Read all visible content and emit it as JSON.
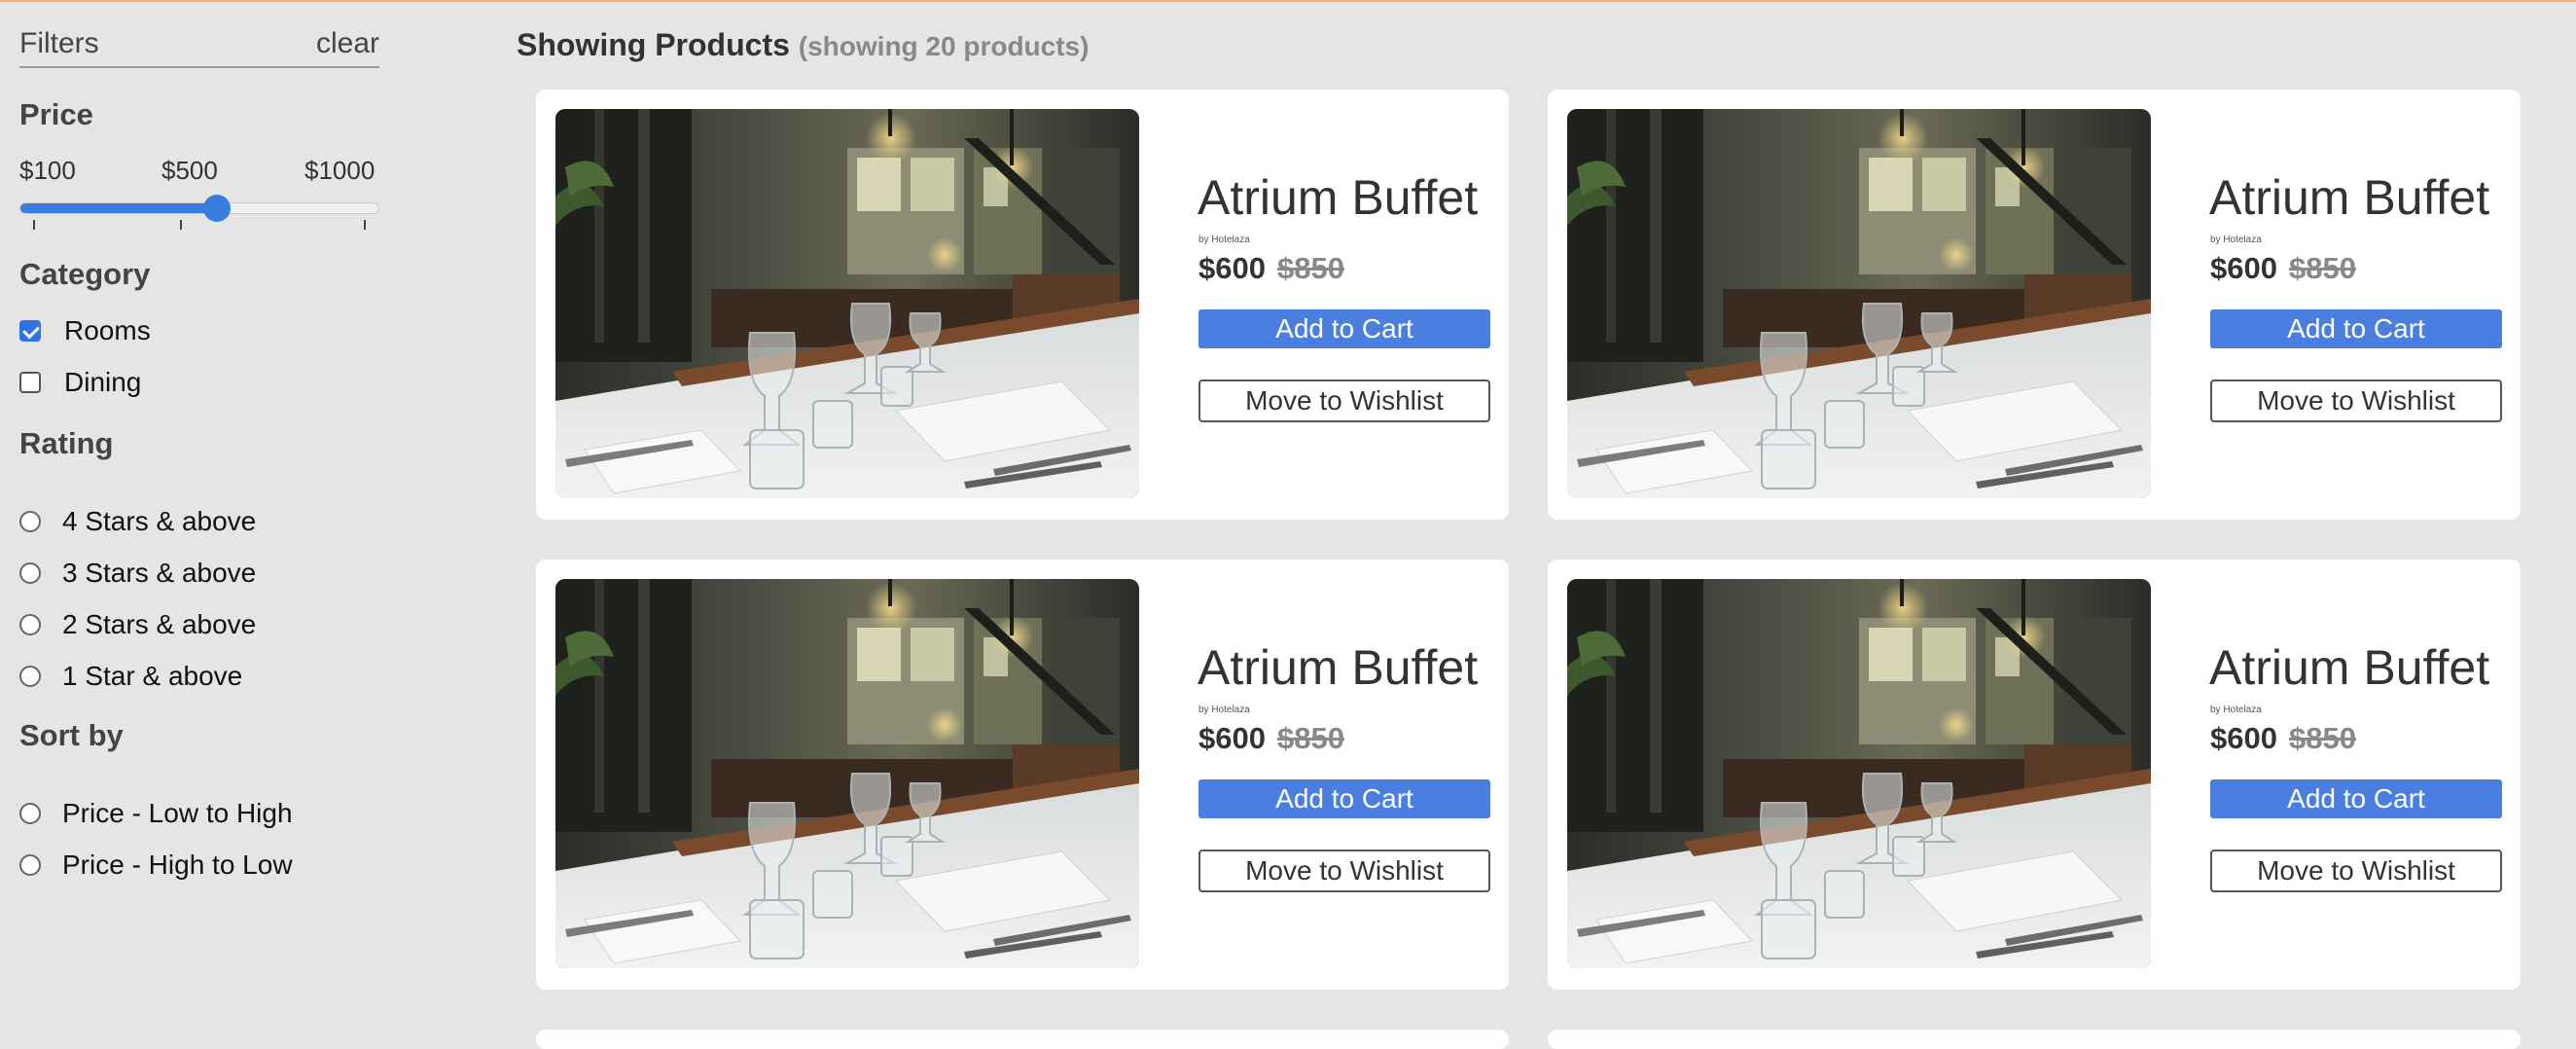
{
  "filters": {
    "title": "Filters",
    "clear_label": "clear",
    "price": {
      "title": "Price",
      "labels": [
        "$100",
        "$500",
        "$1000"
      ],
      "value_fraction": 0.55
    },
    "category": {
      "title": "Category",
      "options": [
        {
          "label": "Rooms",
          "checked": true
        },
        {
          "label": "Dining",
          "checked": false
        }
      ]
    },
    "rating": {
      "title": "Rating",
      "options": [
        "4 Stars & above",
        "3 Stars & above",
        "2 Stars & above",
        "1 Star & above"
      ]
    },
    "sort": {
      "title": "Sort by",
      "options": [
        "Price - Low to High",
        "Price - High to Low"
      ]
    }
  },
  "main": {
    "heading": "Showing Products",
    "count_text": "(showing 20 products)"
  },
  "products": [
    {
      "name": "Atrium Buffet",
      "brand": "by Hotelaza",
      "price": "$600",
      "old_price": "$850",
      "cart_label": "Add to Cart",
      "wishlist_label": "Move to Wishlist"
    },
    {
      "name": "Atrium Buffet",
      "brand": "by Hotelaza",
      "price": "$600",
      "old_price": "$850",
      "cart_label": "Add to Cart",
      "wishlist_label": "Move to Wishlist"
    },
    {
      "name": "Atrium Buffet",
      "brand": "by Hotelaza",
      "price": "$600",
      "old_price": "$850",
      "cart_label": "Add to Cart",
      "wishlist_label": "Move to Wishlist"
    },
    {
      "name": "Atrium Buffet",
      "brand": "by Hotelaza",
      "price": "$600",
      "old_price": "$850",
      "cart_label": "Add to Cart",
      "wishlist_label": "Move to Wishlist"
    }
  ],
  "colors": {
    "accent": "#3a7de0",
    "page_background": "#e5e5e5",
    "top_border": "#f0b27a"
  }
}
